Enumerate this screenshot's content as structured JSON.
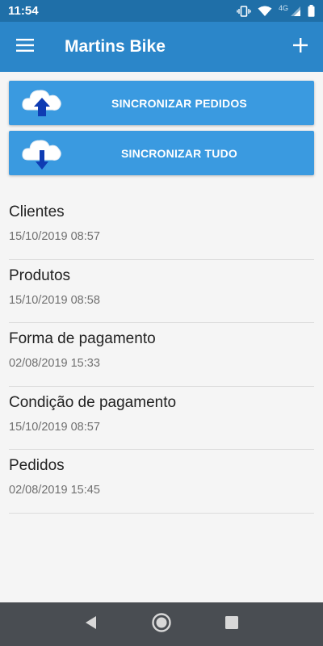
{
  "status": {
    "time": "11:54",
    "network": "4G"
  },
  "app_bar": {
    "title": "Martins Bike"
  },
  "buttons": {
    "sync_orders": "SINCRONIZAR PEDIDOS",
    "sync_all": "SINCRONIZAR TUDO"
  },
  "items": [
    {
      "title": "Clientes",
      "date": "15/10/2019 08:57"
    },
    {
      "title": "Produtos",
      "date": "15/10/2019 08:58"
    },
    {
      "title": "Forma de pagamento",
      "date": "02/08/2019 15:33"
    },
    {
      "title": "Condição de pagamento",
      "date": "15/10/2019 08:57"
    },
    {
      "title": "Pedidos",
      "date": "02/08/2019 15:45"
    }
  ],
  "colors": {
    "status_bar": "#1f6fa8",
    "app_bar": "#2b86c9",
    "button": "#3a9ae0",
    "nav_bar": "#494d52",
    "arrow": "#0f3cb3"
  },
  "icons": [
    "menu-icon",
    "add-icon",
    "cloud-upload-icon",
    "cloud-download-icon",
    "vibrate-icon",
    "wifi-icon",
    "signal-icon",
    "battery-icon",
    "back-icon",
    "home-icon",
    "recents-icon"
  ]
}
